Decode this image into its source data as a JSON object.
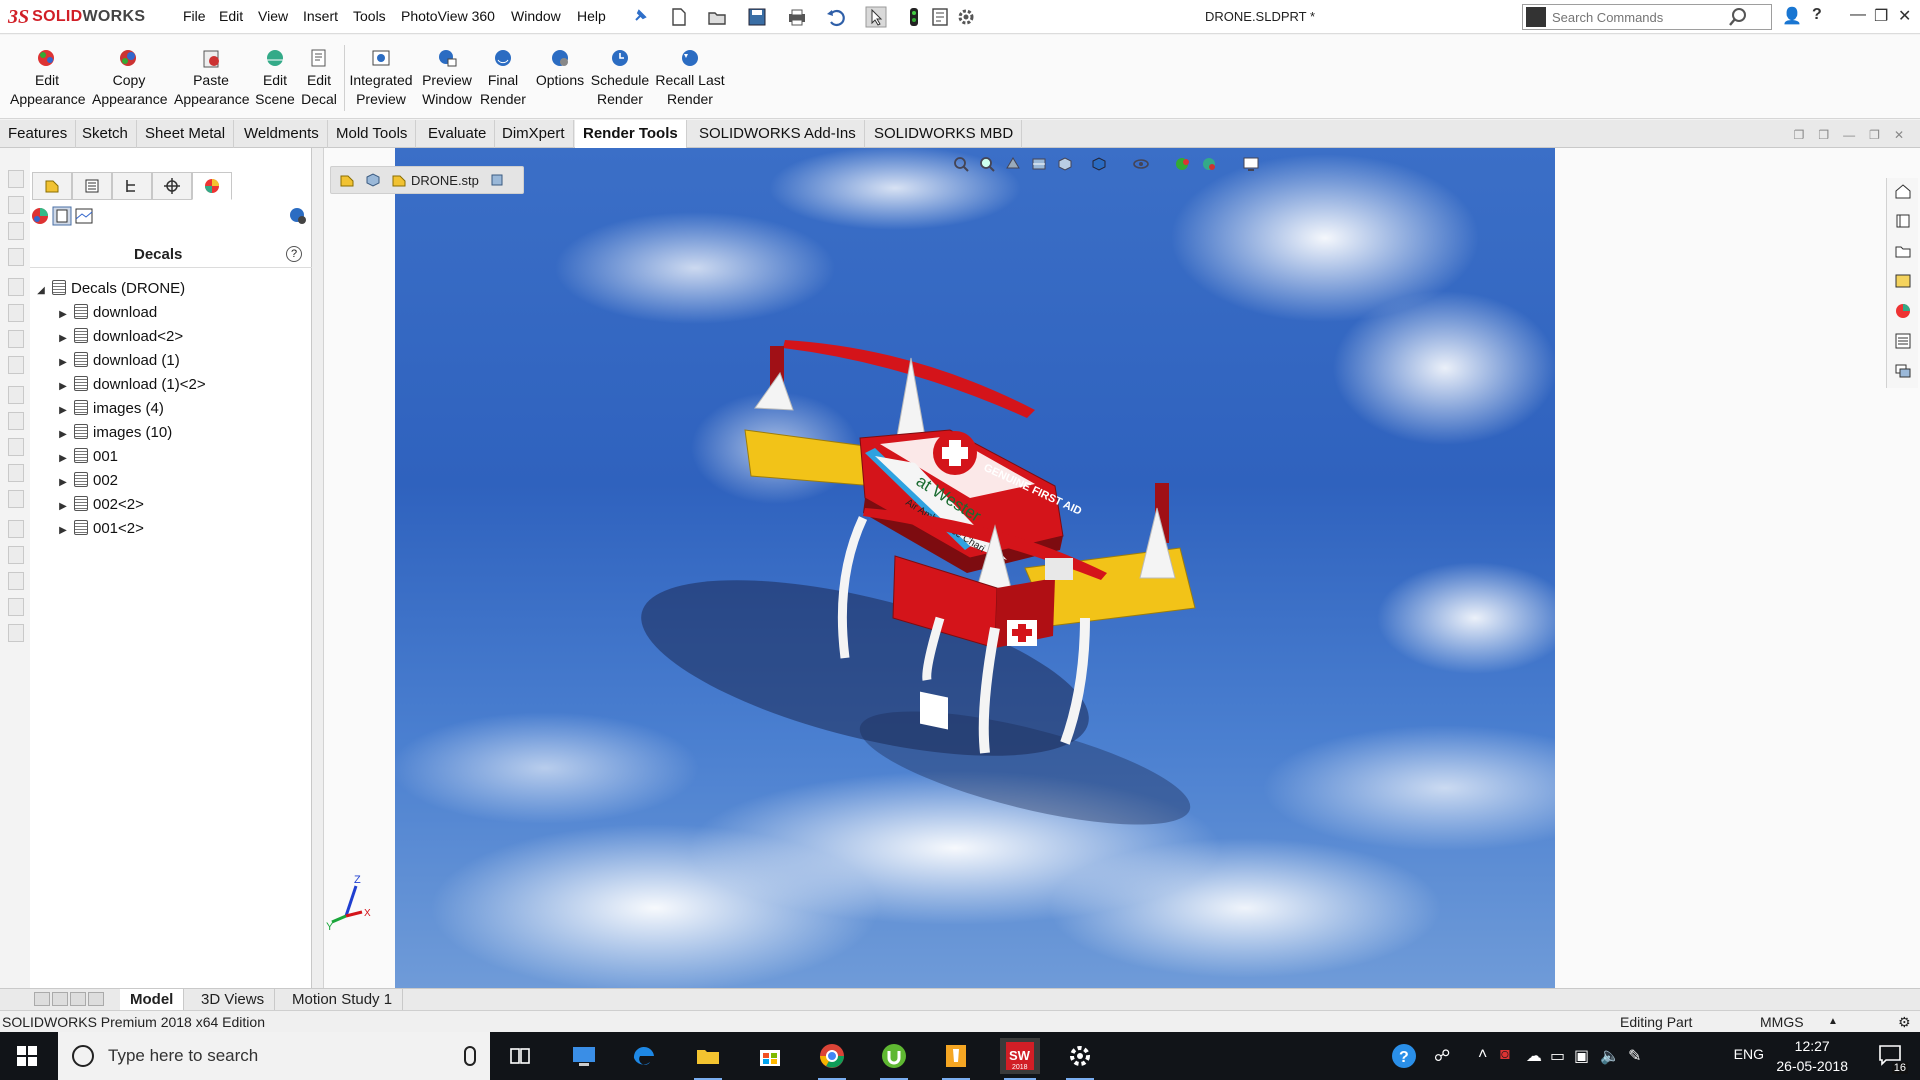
{
  "app": {
    "brand_ds": "3S",
    "brand_solid": "SOLID",
    "brand_works": "WORKS",
    "document_title": "DRONE.SLDPRT *",
    "menus": [
      "File",
      "Edit",
      "View",
      "Insert",
      "Tools",
      "PhotoView 360",
      "Window",
      "Help"
    ],
    "search_placeholder": "Search Commands"
  },
  "ribbon": {
    "buttons": [
      {
        "line1": "Edit",
        "line2": "Appearance"
      },
      {
        "line1": "Copy",
        "line2": "Appearance"
      },
      {
        "line1": "Paste",
        "line2": "Appearance"
      },
      {
        "line1": "Edit",
        "line2": "Scene"
      },
      {
        "line1": "Edit",
        "line2": "Decal"
      },
      {
        "line1": "Integrated",
        "line2": "Preview"
      },
      {
        "line1": "Preview",
        "line2": "Window"
      },
      {
        "line1": "Final",
        "line2": "Render"
      },
      {
        "line1": "Options",
        "line2": ""
      },
      {
        "line1": "Schedule",
        "line2": "Render"
      },
      {
        "line1": "Recall Last",
        "line2": "Render"
      }
    ]
  },
  "tabs": [
    "Features",
    "Sketch",
    "Sheet Metal",
    "Weldments",
    "Mold Tools",
    "Evaluate",
    "DimXpert",
    "Render Tools",
    "SOLIDWORKS Add-Ins",
    "SOLIDWORKS MBD"
  ],
  "active_tab": "Render Tools",
  "panel": {
    "title": "Decals",
    "help": "?",
    "root": "Decals (DRONE)",
    "items": [
      "download",
      "download<2>",
      "download (1)",
      "download (1)<2>",
      "images (4)",
      "images (10)",
      "001",
      "002",
      "002<2>",
      "001<2>"
    ]
  },
  "breadcrumb": {
    "file": "DRONE.stp"
  },
  "scene": {
    "decal_text_1": "GENUINE FIRST AID",
    "decal_text_2": "at Wester",
    "decal_text_3": "Air Ambulance Chari",
    "axis_x": "X",
    "axis_y": "Y",
    "axis_z": "Z"
  },
  "bottom_tabs": [
    "Model",
    "3D Views",
    "Motion Study 1"
  ],
  "active_bottom_tab": "Model",
  "status": {
    "edition": "SOLIDWORKS Premium 2018 x64 Edition",
    "mode": "Editing Part",
    "units": "MMGS",
    "units_arrow": "▲"
  },
  "taskbar": {
    "search_placeholder": "Type here to search",
    "sw_badge": "2018",
    "lang": "ENG",
    "time": "12:27",
    "date": "26-05-2018",
    "notification_count": "16"
  },
  "colors": {
    "brand_red": "#d11e26",
    "sky_blue": "#2f62be",
    "drone_red": "#d4141a",
    "drone_yellow": "#f2c318"
  }
}
